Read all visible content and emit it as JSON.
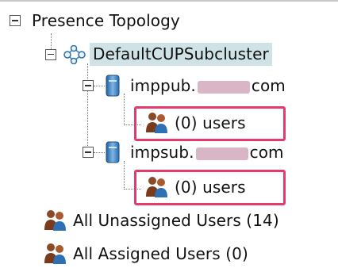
{
  "tree": {
    "root": {
      "label": "Presence Topology"
    },
    "subcluster": {
      "label": "DefaultCUPSubcluster"
    },
    "nodes": [
      {
        "host_prefix": "imppub.",
        "host_suffix": "com",
        "users_label": "(0) users"
      },
      {
        "host_prefix": "impsub.",
        "host_suffix": "com",
        "users_label": "(0) users"
      }
    ],
    "unassigned": {
      "label": "All Unassigned Users (14)"
    },
    "assigned": {
      "label": "All Assigned Users (0)"
    }
  },
  "colors": {
    "highlight_border": "#e53a6b",
    "selection_bg": "#cfe3e6"
  },
  "icons": [
    "collapse-icon",
    "topology-icon",
    "server-icon",
    "users-icon"
  ]
}
